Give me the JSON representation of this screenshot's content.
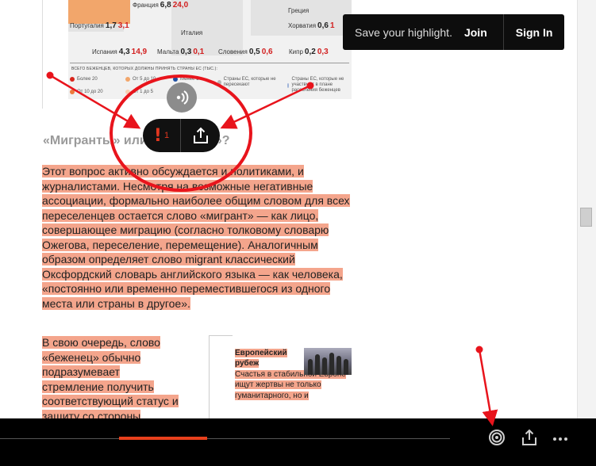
{
  "map": {
    "countries": [
      {
        "name": "Франция",
        "value": "6,8",
        "ratio": "24,0"
      },
      {
        "name": "Греция",
        "value": "",
        "ratio": ""
      },
      {
        "name": "Португалия",
        "value": "1,7",
        "ratio": "3,1"
      },
      {
        "name": "Италия",
        "value": "",
        "ratio": ""
      },
      {
        "name": "Хорватия",
        "value": "0,6",
        "ratio": "1"
      },
      {
        "name": "Испания",
        "value": "4,3",
        "ratio": "14,9"
      },
      {
        "name": "Мальта",
        "value": "0,3",
        "ratio": "0,1"
      },
      {
        "name": "Словения",
        "value": "0,5",
        "ratio": "0,6"
      },
      {
        "name": "Кипр",
        "value": "0,2",
        "ratio": "0,3"
      }
    ],
    "legend_title": "ВСЕГО БЕЖЕНЦЕВ, КОТОРЫХ ДОЛЖНЫ ПРИНЯТЬ СТРАНЫ ЕС (ТЫС.):",
    "legend": [
      {
        "label": "Более 20",
        "color": "#d8261c"
      },
      {
        "label": "От 5 до 10",
        "color": "#f2a66b"
      },
      {
        "label": "Менее 1",
        "color": "#1d4fa3"
      },
      {
        "label": "Страны ЕС, которые не пересекают",
        "color": "#b7b7b7"
      },
      {
        "label": "Страны ЕС, которые не участвуют в плане расселения беженцев",
        "color": "#9fb3d9"
      },
      {
        "label": "От 10 до 20",
        "color": "#ec7a3c"
      },
      {
        "label": "От 1 до 5",
        "color": "#f8d1b3"
      }
    ]
  },
  "article": {
    "heading": "«Мигранты» или «беженцы»?",
    "paragraph1": "Этот вопрос активно обсуждается и политиками, и журналистами. Несмотря на возможные негативные ассоциации, формально наиболее общим словом для всех переселенцев остается слово «мигрант» — как лицо, совершающее миграцию (согласно толковому словарю Ожегова, переселение, перемещение). Аналогичным образом определяет слово migrant классический Оксфордский словарь английского языка — как человека, «постоянно или временно переместившегося из одного места или страны в другое».",
    "paragraph2": "В свою очередь, слово «беженец» обычно подразумевает стремление получить соответствующий статус и защиту со стороны"
  },
  "related": {
    "title": "Европейский рубеж",
    "text": "Счастья в стабильной Европе ищут жертвы не только гуманитарного, но и"
  },
  "popup": {
    "highlight_count": "1",
    "exclamation": "!"
  },
  "banner": {
    "message": "Save your highlight.",
    "join": "Join",
    "sign_in": "Sign In"
  },
  "reading_progress": 0.2
}
